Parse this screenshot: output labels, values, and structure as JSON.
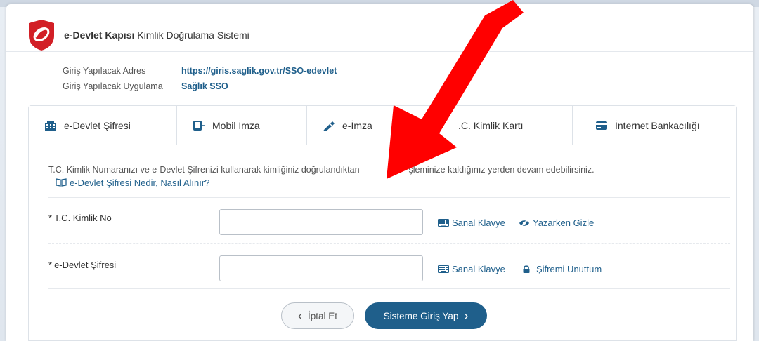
{
  "header": {
    "title_bold": "e-Devlet Kapısı",
    "title_rest": " Kimlik Doğrulama Sistemi",
    "logo_icon": "e-devlet-logo-icon"
  },
  "info": {
    "address_label": "Giriş Yapılacak Adres",
    "address_value": "https://giris.saglik.gov.tr/SSO-edevlet",
    "app_label": "Giriş Yapılacak Uygulama",
    "app_value": "Sağlık SSO"
  },
  "tabs": [
    {
      "label": "e-Devlet Şifresi",
      "icon": "building-icon",
      "active": true
    },
    {
      "label": "Mobil İmza",
      "icon": "mobile-signature-icon",
      "active": false
    },
    {
      "label": "e-İmza",
      "icon": "e-signature-icon",
      "active": false
    },
    {
      "label": ".C. Kimlik Kartı",
      "icon": "id-card-icon",
      "active": false
    },
    {
      "label": "İnternet Bankacılığı",
      "icon": "bank-card-icon",
      "active": false
    }
  ],
  "form": {
    "description_left": "T.C. Kimlik Numaranızı ve e-Devlet Şifrenizi kullanarak kimliğiniz doğrulandıktan",
    "description_right": "şleminize kaldığınız yerden devam edebilirsiniz.",
    "help_link": "e-Devlet Şifresi Nedir, Nasıl Alınır?",
    "tc_label": "T.C. Kimlik No",
    "tc_value": "",
    "password_label": "e-Devlet Şifresi",
    "password_value": "",
    "required_mark": "*",
    "virtual_keyboard": "Sanal Klavye",
    "hide_while_typing": "Yazarken Gizle",
    "forgot_password": "Şifremi Unuttum"
  },
  "buttons": {
    "cancel": "İptal Et",
    "submit": "Sisteme Giriş Yap"
  },
  "colors": {
    "brand_blue": "#1f5f8b",
    "logo_red": "#d21f26",
    "annotation_arrow": "#ff0000"
  }
}
